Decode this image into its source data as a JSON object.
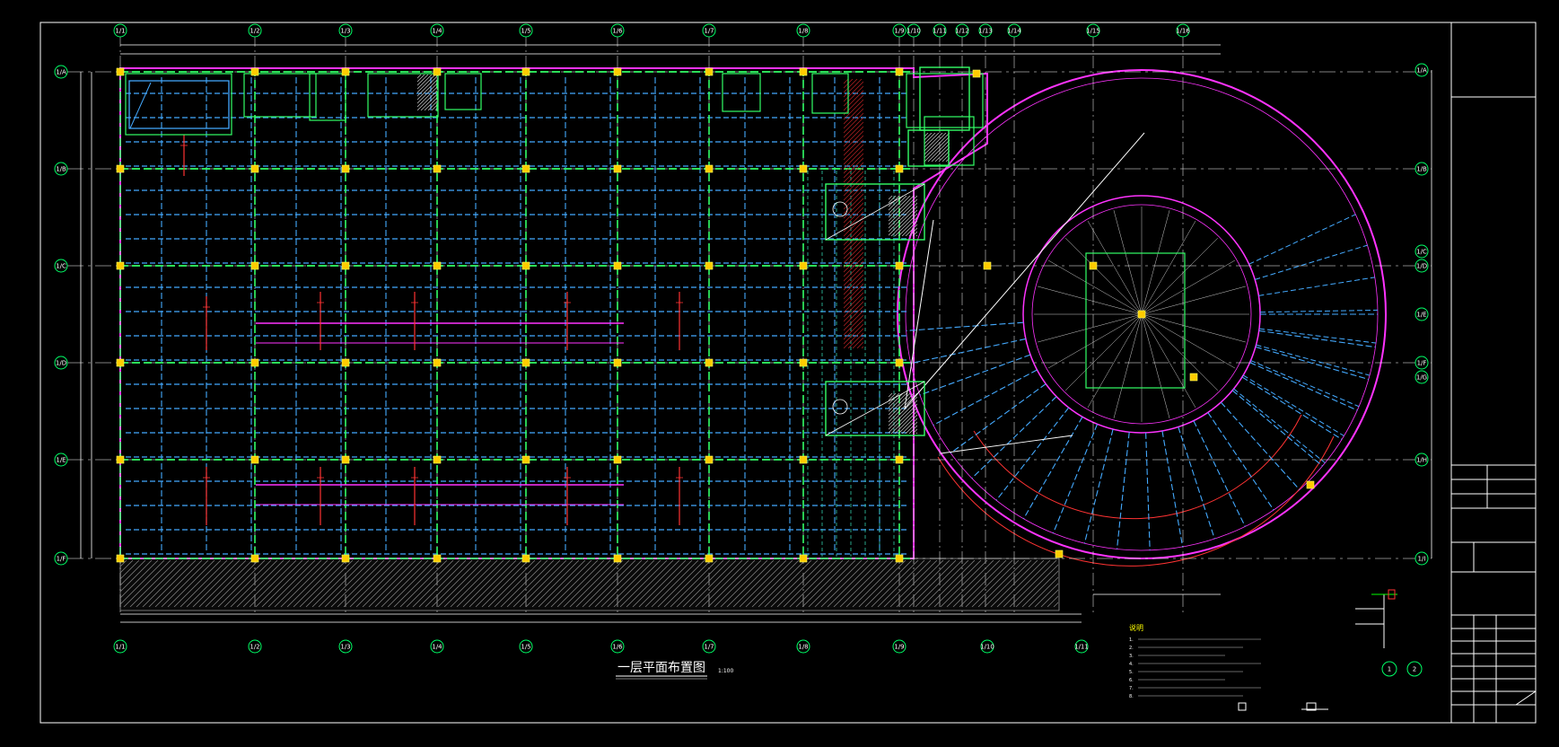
{
  "plan_title": "一层平面布置图",
  "scale_label": "1:100",
  "top_axes": [
    "1/1",
    "1/2",
    "1/3",
    "1/4",
    "1/5",
    "1/6",
    "1/7",
    "1/8",
    "1/9",
    "1/10",
    "1/11",
    "1/12",
    "1/13",
    "1/14",
    "1/15",
    "1/16"
  ],
  "bottom_axes": [
    "1/1",
    "1/2",
    "1/3",
    "1/4",
    "1/5",
    "1/6",
    "1/7",
    "1/8",
    "1/9",
    "1/10",
    "1/11"
  ],
  "left_axes": [
    "1/A",
    "1/B",
    "1/C",
    "1/D",
    "1/E",
    "1/F"
  ],
  "right_axes": [
    "1/A",
    "1/B",
    "1/C",
    "1/D",
    "1/E",
    "1/F",
    "1/G",
    "1/H",
    "1/I"
  ],
  "notes": {
    "title": "说明",
    "lines": [
      "1.",
      "2.",
      "3.",
      "4.",
      "5.",
      "6.",
      "7.",
      "8."
    ]
  },
  "detail_refs": [
    "1",
    "2"
  ]
}
